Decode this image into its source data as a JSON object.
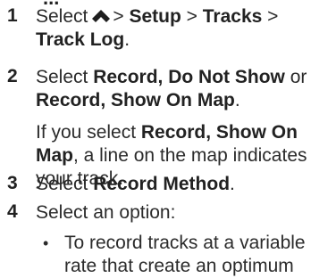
{
  "doc": {
    "cut_heading": "...",
    "steps": [
      {
        "num": "1",
        "parts": [
          "Select",
          "> ",
          "Setup",
          " > ",
          "Tracks",
          " > ",
          "Track Log",
          "."
        ]
      },
      {
        "num": "2",
        "parts": [
          "Select ",
          "Record, Do Not Show",
          " or ",
          "Record, Show On Map",
          "."
        ],
        "note_parts": [
          "If you select ",
          "Record, Show On Map",
          ", a line on the map indicates your track."
        ]
      },
      {
        "num": "3",
        "parts": [
          "Select ",
          "Record Method",
          "."
        ]
      },
      {
        "num": "4",
        "parts": [
          "Select an option:"
        ],
        "bullets": [
          "To record tracks at a variable rate that create an optimum"
        ]
      }
    ],
    "icons": {
      "menu_caret": "caret-up-icon"
    }
  }
}
